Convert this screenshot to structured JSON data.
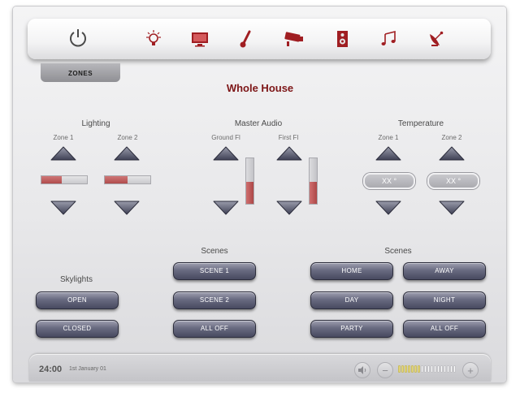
{
  "header": {
    "icons": [
      "power-icon",
      "lightbulb-icon",
      "monitor-icon",
      "thermometer-icon",
      "security-camera-icon",
      "speaker-icon",
      "music-note-icon",
      "satellite-dish-icon"
    ],
    "zones_tab": "ZONES"
  },
  "page_title": "Whole House",
  "lighting": {
    "title": "Lighting",
    "zones": [
      {
        "label": "Zone 1",
        "level": 0.45
      },
      {
        "label": "Zone 2",
        "level": 0.5
      }
    ]
  },
  "master_audio": {
    "title": "Master Audio",
    "zones": [
      {
        "label": "Ground Fl",
        "level": 0.48
      },
      {
        "label": "First Fl",
        "level": 0.48
      }
    ]
  },
  "temperature": {
    "title": "Temperature",
    "zones": [
      {
        "label": "Zone 1",
        "value": "XX °"
      },
      {
        "label": "Zone 2",
        "value": "XX °"
      }
    ]
  },
  "skylights": {
    "title": "Skylights",
    "buttons": [
      "OPEN",
      "CLOSED"
    ]
  },
  "scenes_left": {
    "title": "Scenes",
    "buttons": [
      "SCENE 1",
      "SCENE 2",
      "ALL OFF"
    ]
  },
  "scenes_right": {
    "title": "Scenes",
    "buttons": [
      "HOME",
      "AWAY",
      "DAY",
      "NIGHT",
      "PARTY",
      "ALL OFF"
    ]
  },
  "footer": {
    "time": "24:00",
    "date": "1st January 01",
    "volume_level": 0.4
  },
  "colors": {
    "accent": "#7d1617",
    "icon_red": "#a01e22",
    "button": "#5f6178",
    "volume_on": "#e8dc84",
    "volume_off": "#ffffff"
  }
}
